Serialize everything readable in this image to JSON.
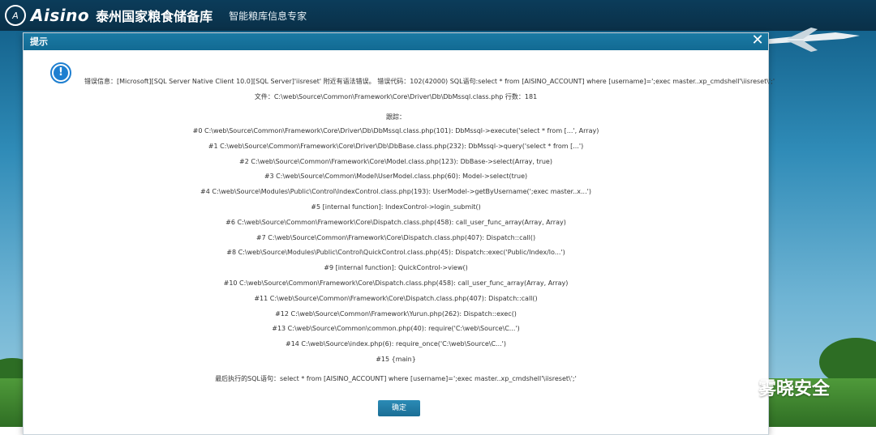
{
  "header": {
    "brand": "Aisino",
    "org": "泰州国家粮食储备库",
    "slogan": "智能粮库信息专家"
  },
  "dialog": {
    "title": "提示",
    "close_icon": "close-icon",
    "error_line": "错误信息：[Microsoft][SQL Server Native Client 10.0][SQL Server]'iisreset' 附近有语法错误。 错误代码：102(42000) SQL语句:select * from [AISINO_ACCOUNT] where [username]=';exec master..xp_cmdshell'\\iisreset\\';'",
    "file_line": "文件：C:\\web\\Source\\Common\\Framework\\Core\\Driver\\Db\\DbMssql.class.php 行数：181",
    "trace_label": "跟踪：",
    "trace": [
      "#0 C:\\web\\Source\\Common\\Framework\\Core\\Driver\\Db\\DbMssql.class.php(101): DbMssql->execute('select * from [...', Array)",
      "#1 C:\\web\\Source\\Common\\Framework\\Core\\Driver\\Db\\DbBase.class.php(232): DbMssql->query('select * from [...')",
      "#2 C:\\web\\Source\\Common\\Framework\\Core\\Model.class.php(123): DbBase->select(Array, true)",
      "#3 C:\\web\\Source\\Common\\Model\\UserModel.class.php(60): Model->select(true)",
      "#4 C:\\web\\Source\\Modules\\Public\\Control\\IndexControl.class.php(193): UserModel->getByUsername(';exec master..x...')",
      "#5 [internal function]: IndexControl->login_submit()",
      "#6 C:\\web\\Source\\Common\\Framework\\Core\\Dispatch.class.php(458): call_user_func_array(Array, Array)",
      "#7 C:\\web\\Source\\Common\\Framework\\Core\\Dispatch.class.php(407): Dispatch::call()",
      "#8 C:\\web\\Source\\Modules\\Public\\Control\\QuickControl.class.php(45): Dispatch::exec('Public/Index/lo...')",
      "#9 [internal function]: QuickControl->view()",
      "#10 C:\\web\\Source\\Common\\Framework\\Core\\Dispatch.class.php(458): call_user_func_array(Array, Array)",
      "#11 C:\\web\\Source\\Common\\Framework\\Core\\Dispatch.class.php(407): Dispatch::call()",
      "#12 C:\\web\\Source\\Common\\Framework\\Yurun.php(262): Dispatch::exec()",
      "#13 C:\\web\\Source\\Common\\common.php(40): require('C:\\web\\Source\\C...')",
      "#14 C:\\web\\Source\\index.php(6): require_once('C:\\web\\Source\\C...')",
      "#15 {main}"
    ],
    "last_sql": "最后执行的SQL语句：select * from [AISINO_ACCOUNT] where [username]=';exec master..xp_cmdshell'\\iisreset\\';'",
    "ok_label": "确定"
  },
  "watermark": {
    "text": "雾晓安全",
    "icon": "wechat-icon"
  }
}
